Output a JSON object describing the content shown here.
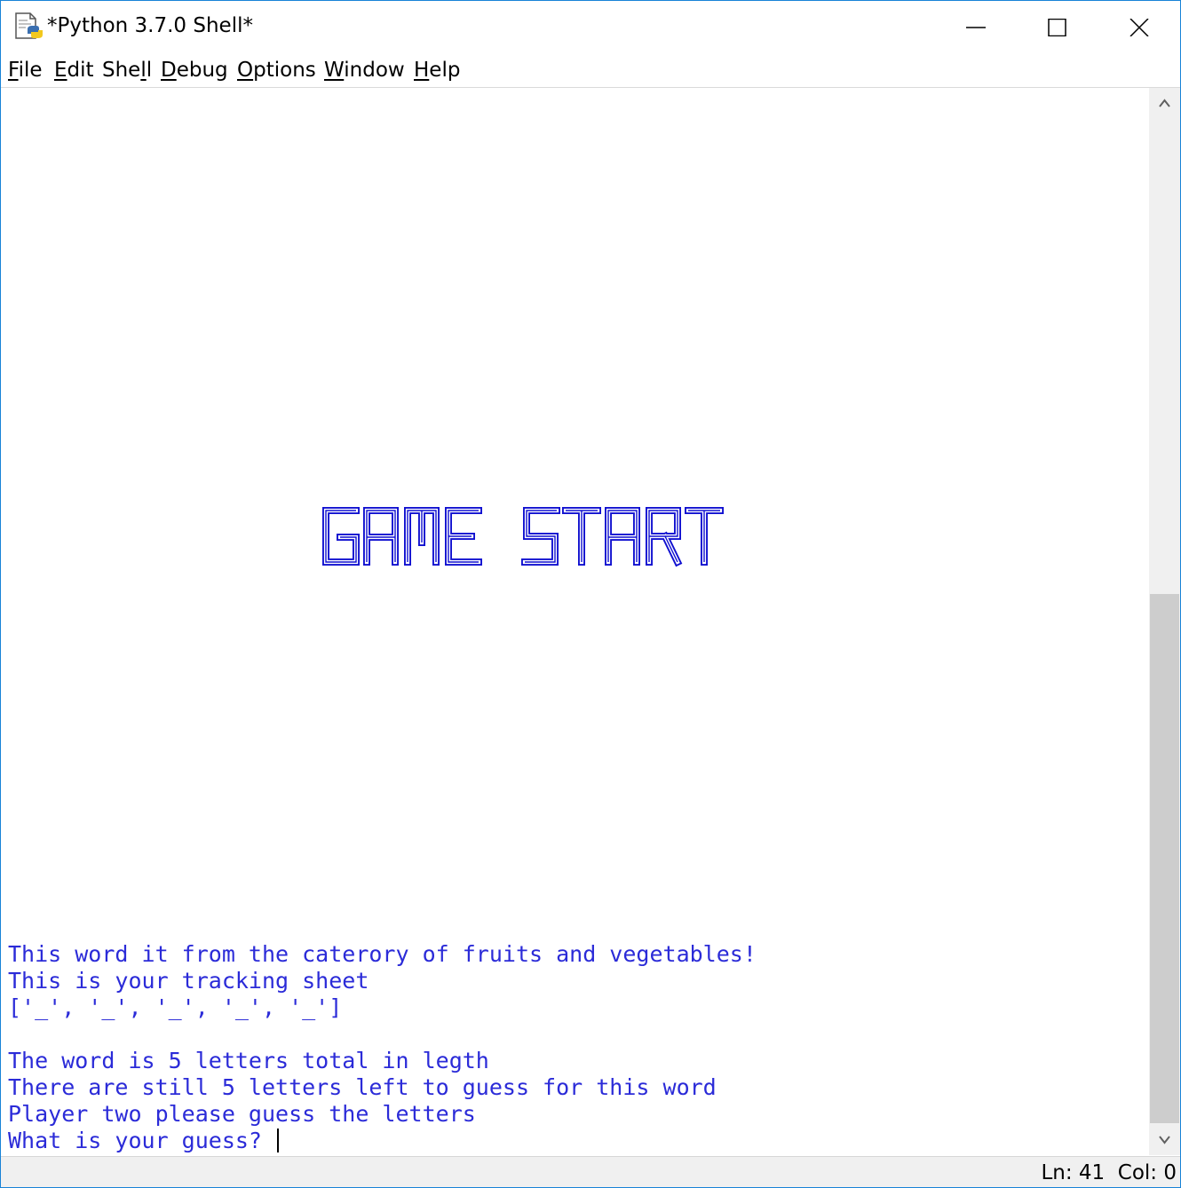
{
  "window": {
    "title": "*Python 3.7.0 Shell*",
    "icon": "python-idle-icon"
  },
  "menu": [
    {
      "pre": "",
      "ul": "F",
      "post": "ile"
    },
    {
      "pre": "",
      "ul": "E",
      "post": "dit"
    },
    {
      "pre": "She",
      "ul": "l",
      "post": "l"
    },
    {
      "pre": "",
      "ul": "D",
      "post": "ebug"
    },
    {
      "pre": "",
      "ul": "O",
      "post": "ptions"
    },
    {
      "pre": "",
      "ul": "W",
      "post": "indow"
    },
    {
      "pre": "",
      "ul": "H",
      "post": "elp"
    }
  ],
  "banner": {
    "text": "GAME START",
    "color": "#1010d0"
  },
  "output": {
    "line1": "This word it from the caterory of fruits and vegetables!",
    "line2": "This is your tracking sheet",
    "line3": "['_', '_', '_', '_', '_']",
    "line4": "The word is 5 letters total in legth",
    "line5": "There are still 5 letters left to guess for this word",
    "line6": "Player two please guess the letters",
    "line7": "What is your guess? "
  },
  "colors": {
    "output_text": "#2b2bd8",
    "window_border": "#1883d7"
  },
  "status": {
    "text": "Ln: 41  Col: 0"
  }
}
